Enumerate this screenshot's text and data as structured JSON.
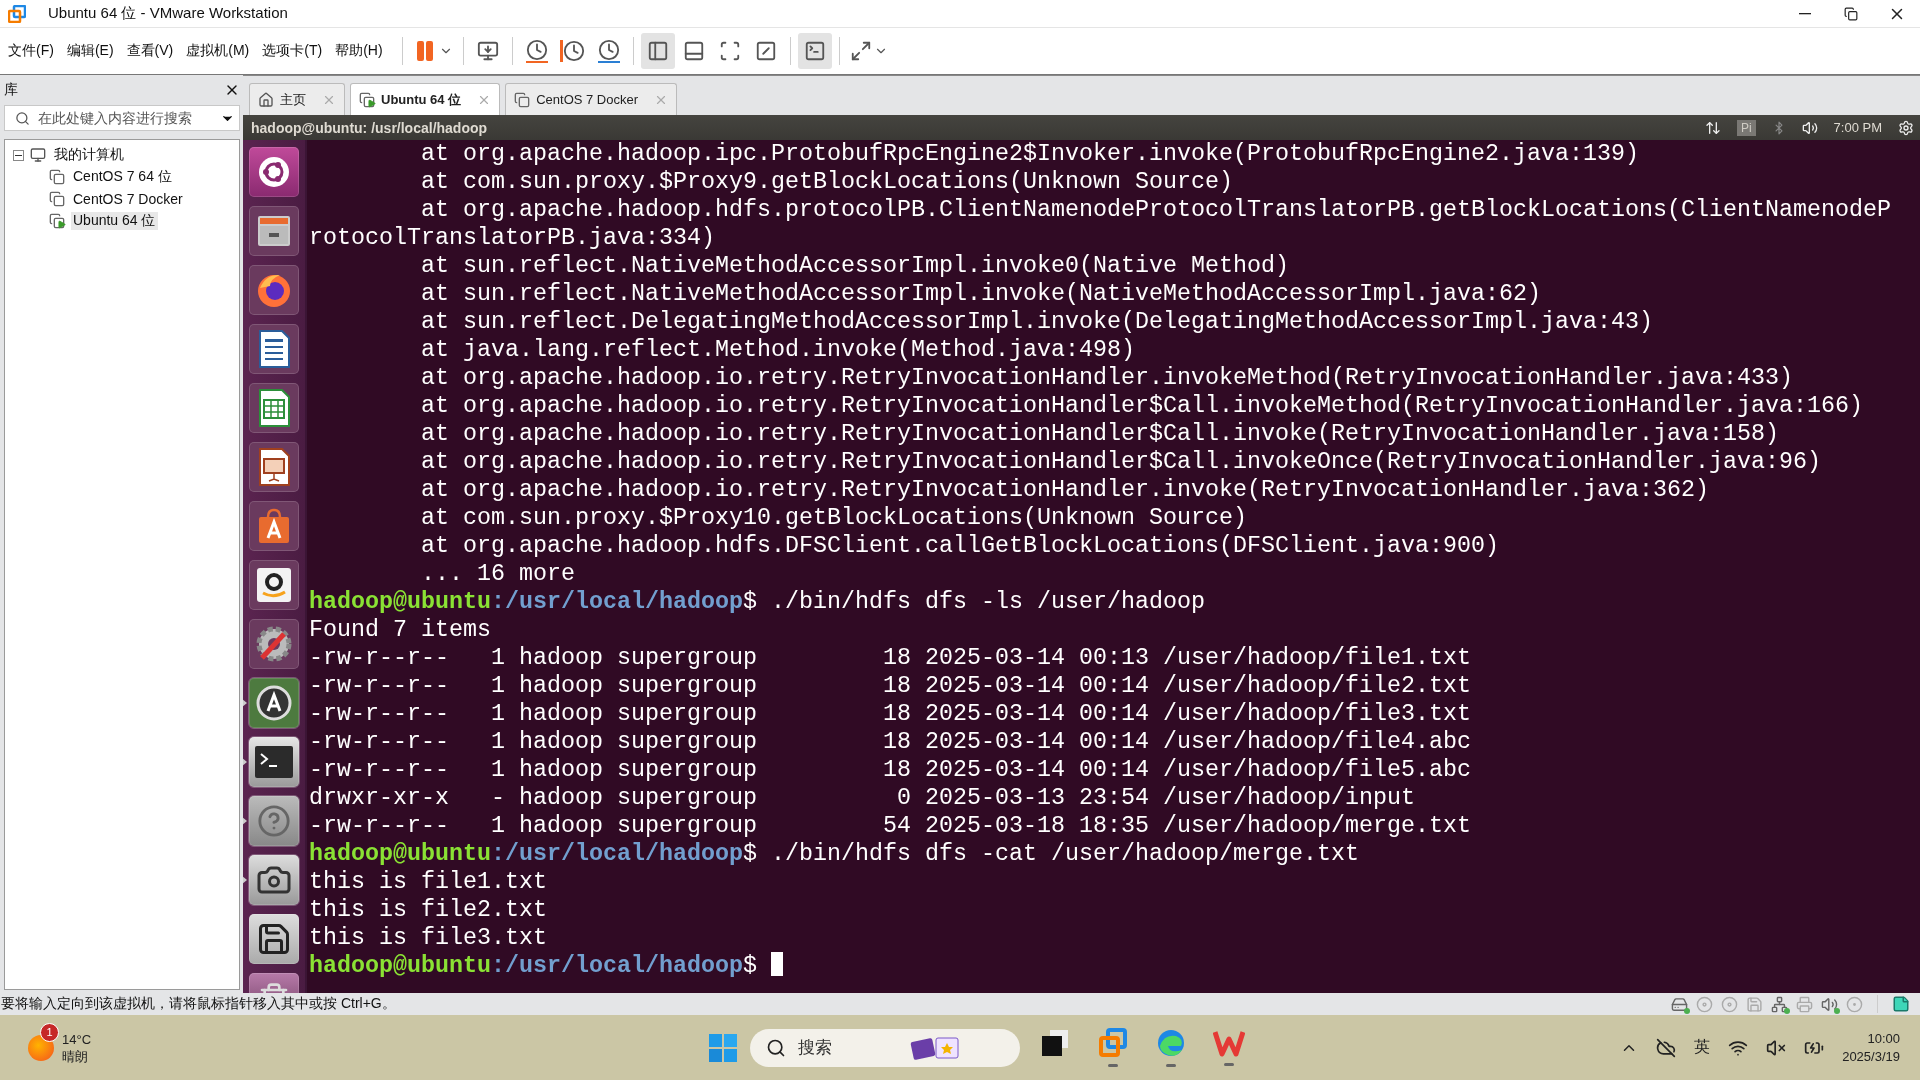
{
  "window": {
    "title": "Ubuntu 64 位 - VMware Workstation"
  },
  "menu": [
    "文件(F)",
    "编辑(E)",
    "查看(V)",
    "虚拟机(M)",
    "选项卡(T)",
    "帮助(H)"
  ],
  "toolbar": [
    {
      "kind": "pause",
      "pressed": false
    },
    {
      "kind": "send-keys",
      "pressed": false
    },
    {
      "kind": "snapshot-take",
      "pressed": false
    },
    {
      "kind": "snapshot-revert",
      "pressed": false
    },
    {
      "kind": "snapshot-manager",
      "pressed": false
    },
    {
      "kind": "library-view",
      "pressed": true
    },
    {
      "kind": "thumbnail-view",
      "pressed": false
    },
    {
      "kind": "full-screen",
      "pressed": false
    },
    {
      "kind": "unity",
      "pressed": false
    },
    {
      "kind": "console",
      "pressed": true
    },
    {
      "kind": "stretch",
      "pressed": false
    }
  ],
  "library": {
    "title": "库",
    "search": {
      "placeholder": "在此处键入内容进行搜索"
    },
    "tree": [
      {
        "label": "我的计算机",
        "expanded": true,
        "children": [
          {
            "label": "CentOS 7 64 位",
            "selected": false,
            "running": false
          },
          {
            "label": "CentOS 7 Docker",
            "selected": false,
            "running": false
          },
          {
            "label": "Ubuntu 64 位",
            "selected": true,
            "running": true
          }
        ]
      }
    ]
  },
  "tabs": [
    {
      "kind": "home",
      "label": "主页",
      "selected": false
    },
    {
      "kind": "vm",
      "label": "Ubuntu 64 位",
      "selected": true,
      "running": true
    },
    {
      "kind": "vm",
      "label": "CentOS 7 Docker",
      "selected": false,
      "running": false
    }
  ],
  "guest": {
    "title": "hadoop@ubuntu: /usr/local/hadoop",
    "keyboard": "Pi",
    "clock": "7:00 PM",
    "launcher": [
      {
        "kind": "ubuntu",
        "running": false
      },
      {
        "kind": "files",
        "running": false
      },
      {
        "kind": "browser",
        "running": false
      },
      {
        "kind": "writer",
        "running": false
      },
      {
        "kind": "calc",
        "running": false
      },
      {
        "kind": "impress",
        "running": false
      },
      {
        "kind": "software",
        "running": false
      },
      {
        "kind": "amazon",
        "running": false
      },
      {
        "kind": "settings",
        "running": false
      },
      {
        "kind": "updater",
        "running": true
      },
      {
        "kind": "terminal",
        "running": true
      },
      {
        "kind": "help",
        "running": true
      },
      {
        "kind": "camera",
        "running": true
      },
      {
        "kind": "floppy",
        "running": false
      },
      {
        "kind": "trash",
        "running": false
      }
    ],
    "terminal": [
      {
        "kind": "output",
        "text": "        at org.apache.hadoop.ipc.ProtobufRpcEngine2$Invoker.invoke(ProtobufRpcEngine2.java:139)"
      },
      {
        "kind": "output",
        "text": "        at com.sun.proxy.$Proxy9.getBlockLocations(Unknown Source)"
      },
      {
        "kind": "output",
        "text": "        at org.apache.hadoop.hdfs.protocolPB.ClientNamenodeProtocolTranslatorPB.getBlockLocations(ClientNamenodeProtocolTranslatorPB.java:334)"
      },
      {
        "kind": "output",
        "text": "        at sun.reflect.NativeMethodAccessorImpl.invoke0(Native Method)"
      },
      {
        "kind": "output",
        "text": "        at sun.reflect.NativeMethodAccessorImpl.invoke(NativeMethodAccessorImpl.java:62)"
      },
      {
        "kind": "output",
        "text": "        at sun.reflect.DelegatingMethodAccessorImpl.invoke(DelegatingMethodAccessorImpl.java:43)"
      },
      {
        "kind": "output",
        "text": "        at java.lang.reflect.Method.invoke(Method.java:498)"
      },
      {
        "kind": "output",
        "text": "        at org.apache.hadoop.io.retry.RetryInvocationHandler.invokeMethod(RetryInvocationHandler.java:433)"
      },
      {
        "kind": "output",
        "text": "        at org.apache.hadoop.io.retry.RetryInvocationHandler$Call.invokeMethod(RetryInvocationHandler.java:166)"
      },
      {
        "kind": "output",
        "text": "        at org.apache.hadoop.io.retry.RetryInvocationHandler$Call.invoke(RetryInvocationHandler.java:158)"
      },
      {
        "kind": "output",
        "text": "        at org.apache.hadoop.io.retry.RetryInvocationHandler$Call.invokeOnce(RetryInvocationHandler.java:96)"
      },
      {
        "kind": "output",
        "text": "        at org.apache.hadoop.io.retry.RetryInvocationHandler.invoke(RetryInvocationHandler.java:362)"
      },
      {
        "kind": "output",
        "text": "        at com.sun.proxy.$Proxy10.getBlockLocations(Unknown Source)"
      },
      {
        "kind": "output",
        "text": "        at org.apache.hadoop.hdfs.DFSClient.callGetBlockLocations(DFSClient.java:900)"
      },
      {
        "kind": "output",
        "text": "        ... 16 more"
      },
      {
        "kind": "prompt",
        "user": "hadoop@ubuntu",
        "path": ":/usr/local/hadoop",
        "command": "$ ./bin/hdfs dfs -ls /user/hadoop",
        "cursor": false
      },
      {
        "kind": "output",
        "text": "Found 7 items"
      },
      {
        "kind": "output",
        "text": "-rw-r--r--   1 hadoop supergroup         18 2025-03-14 00:13 /user/hadoop/file1.txt"
      },
      {
        "kind": "output",
        "text": "-rw-r--r--   1 hadoop supergroup         18 2025-03-14 00:14 /user/hadoop/file2.txt"
      },
      {
        "kind": "output",
        "text": "-rw-r--r--   1 hadoop supergroup         18 2025-03-14 00:14 /user/hadoop/file3.txt"
      },
      {
        "kind": "output",
        "text": "-rw-r--r--   1 hadoop supergroup         18 2025-03-14 00:14 /user/hadoop/file4.abc"
      },
      {
        "kind": "output",
        "text": "-rw-r--r--   1 hadoop supergroup         18 2025-03-14 00:14 /user/hadoop/file5.abc"
      },
      {
        "kind": "output",
        "text": "drwxr-xr-x   - hadoop supergroup          0 2025-03-13 23:54 /user/hadoop/input"
      },
      {
        "kind": "output",
        "text": "-rw-r--r--   1 hadoop supergroup         54 2025-03-18 18:35 /user/hadoop/merge.txt"
      },
      {
        "kind": "prompt",
        "user": "hadoop@ubuntu",
        "path": ":/usr/local/hadoop",
        "command": "$ ./bin/hdfs dfs -cat /user/hadoop/merge.txt",
        "cursor": false
      },
      {
        "kind": "output",
        "text": "this is file1.txt"
      },
      {
        "kind": "output",
        "text": "this is file2.txt"
      },
      {
        "kind": "output",
        "text": "this is file3.txt"
      },
      {
        "kind": "prompt",
        "user": "hadoop@ubuntu",
        "path": ":/usr/local/hadoop",
        "command": "$ ",
        "cursor": true
      }
    ]
  },
  "status_bar": {
    "message": "要将输入定向到该虚拟机，请将鼠标指针移入其中或按 Ctrl+G。",
    "devices": [
      {
        "kind": "disk",
        "connected": true
      },
      {
        "kind": "cd",
        "connected": false
      },
      {
        "kind": "cd",
        "connected": false
      },
      {
        "kind": "floppy",
        "connected": false
      },
      {
        "kind": "network",
        "connected": true
      },
      {
        "kind": "printer",
        "connected": false
      },
      {
        "kind": "sound",
        "connected": true
      },
      {
        "kind": "usb",
        "connected": false
      }
    ]
  },
  "taskbar": {
    "weather": {
      "badge": "1",
      "temperature": "14°C",
      "condition": "晴朗"
    },
    "search": {
      "placeholder": "搜索"
    },
    "apps": [
      {
        "kind": "task-view",
        "running": false
      },
      {
        "kind": "vmware",
        "running": true
      },
      {
        "kind": "edge",
        "running": true
      },
      {
        "kind": "wps",
        "running": true
      }
    ],
    "tray": {
      "language": "英",
      "time": "10:00",
      "date": "2025/3/19"
    }
  }
}
